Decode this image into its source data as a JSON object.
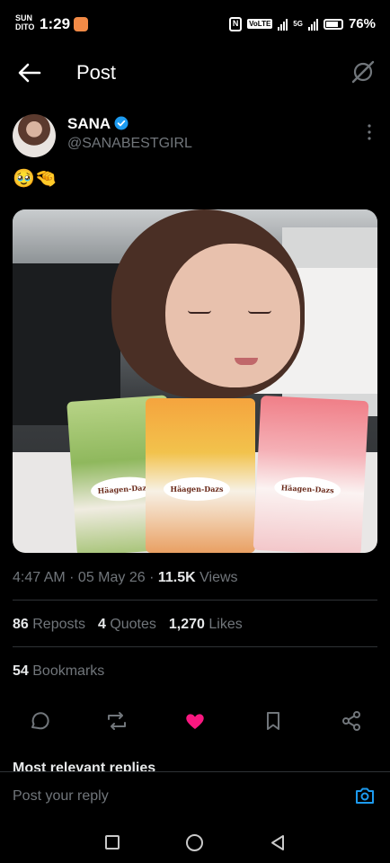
{
  "status_bar": {
    "day": "SUN",
    "carrier": "DITO",
    "time": "1:29",
    "battery": "76%",
    "volte": "VoLTE",
    "network": "5G"
  },
  "header": {
    "title": "Post"
  },
  "author": {
    "name": "SANA",
    "handle": "@SANABESTGIRL"
  },
  "post": {
    "text": "🥹🤏",
    "media_labels": [
      "Häagen-Dazs",
      "Häagen-Dazs",
      "Häagen-Dazs"
    ]
  },
  "meta": {
    "time": "4:47 AM",
    "date": "05 May 26",
    "views_count": "11.5K",
    "views_label": "Views"
  },
  "stats": {
    "reposts_count": "86",
    "reposts_label": "Reposts",
    "quotes_count": "4",
    "quotes_label": "Quotes",
    "likes_count": "1,270",
    "likes_label": "Likes",
    "bookmarks_count": "54",
    "bookmarks_label": "Bookmarks"
  },
  "replies": {
    "header": "Most relevant replies"
  },
  "reply_bar": {
    "placeholder": "Post your reply"
  },
  "colors": {
    "background": "#000000",
    "accent": "#1d9bf0",
    "like": "#f91880",
    "muted": "#71767b"
  },
  "icons": {
    "back": "arrow-left-icon",
    "grok": "grok-icon",
    "verified": "verified-badge-icon",
    "more": "more-vertical-icon",
    "reply": "reply-icon",
    "repost": "repost-icon",
    "like": "heart-icon",
    "bookmark": "bookmark-icon",
    "share": "share-icon",
    "camera": "camera-icon"
  }
}
